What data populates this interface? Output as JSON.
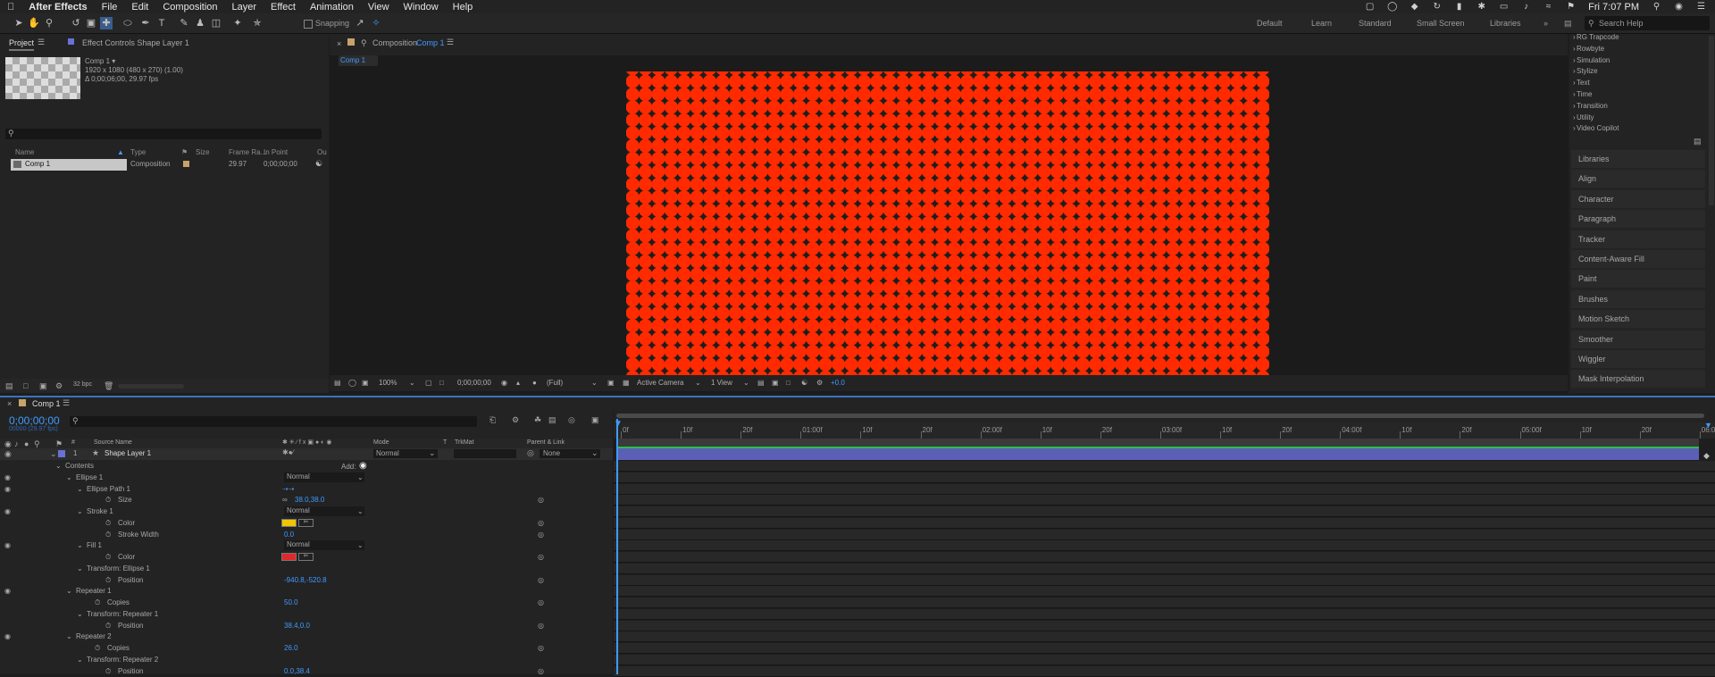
{
  "menubar": {
    "app": "After Effects",
    "items": [
      "File",
      "Edit",
      "Composition",
      "Layer",
      "Effect",
      "Animation",
      "View",
      "Window",
      "Help"
    ],
    "clock": "Fri 7:07 PM"
  },
  "toolbar": {
    "snapping": "Snapping",
    "workspaces": [
      "Default",
      "Learn",
      "Standard",
      "Small Screen",
      "Libraries"
    ],
    "search_help": "Search Help"
  },
  "project": {
    "tab": "Project",
    "tab2": "Effect Controls Shape Layer 1",
    "comp_name": "Comp 1 ▾",
    "info1": "1920 x 1080  (480 x 270) (1.00)",
    "info2": "Δ 0;00;06;00, 29.97 fps",
    "columns": [
      "Name",
      "Type",
      "Size",
      "Frame Ra...",
      "In Point",
      "Ou"
    ],
    "row": {
      "name": "Comp 1",
      "type": "Composition",
      "fps": "29.97",
      "inpoint": "0;00;00;00"
    },
    "bpc": "32 bpc"
  },
  "viewer": {
    "tab_prefix": "Composition",
    "tab_comp": "Comp 1",
    "breadcrumb": "Comp 1",
    "zoom": "100%",
    "time": "0;00;00;00",
    "resolution": "(Full)",
    "camera": "Active Camera",
    "views": "1 View",
    "exposure": "+0.0",
    "colors": {
      "dot": "#ff2a00",
      "bg": "#1e1e1e"
    }
  },
  "effects": {
    "cats": [
      "RG Trapcode",
      "Rowbyte",
      "Simulation",
      "Stylize",
      "Text",
      "Time",
      "Transition",
      "Utility",
      "Video Copilot"
    ],
    "panels": [
      "Libraries",
      "Align",
      "Character",
      "Paragraph",
      "Tracker",
      "Content-Aware Fill",
      "Paint",
      "Brushes",
      "Motion Sketch",
      "Smoother",
      "Wiggler",
      "Mask Interpolation"
    ]
  },
  "timeline": {
    "tab": "Comp 1",
    "timecode": "0;00;00;00",
    "sub": "00000 (29.97 fps)",
    "cols": {
      "num": "#",
      "source": "Source Name",
      "mode": "Mode",
      "t": "T",
      "trkmat": "TrkMat",
      "parent": "Parent & Link"
    },
    "layer": {
      "num": "1",
      "name": "Shape Layer 1",
      "mode": "Normal",
      "parent": "None"
    },
    "add": "Add:",
    "rows": [
      {
        "label": "Contents",
        "indent": 1
      },
      {
        "label": "Ellipse 1",
        "indent": 2,
        "value": "Normal",
        "dropdown": true,
        "eye": true
      },
      {
        "label": "Ellipse Path 1",
        "indent": 3,
        "eye": true
      },
      {
        "label": "Size",
        "indent": 4,
        "value": "38.0,38.0",
        "blue": true,
        "stopwatch": true
      },
      {
        "label": "Stroke 1",
        "indent": 3,
        "value": "Normal",
        "dropdown": true,
        "eye": true
      },
      {
        "label": "Color",
        "indent": 4,
        "swatch": "#f2c400",
        "stopwatch": true
      },
      {
        "label": "Stroke Width",
        "indent": 4,
        "value": "0.0",
        "blue": true,
        "stopwatch": true
      },
      {
        "label": "Fill 1",
        "indent": 3,
        "value": "Normal",
        "dropdown": true,
        "eye": true
      },
      {
        "label": "Color",
        "indent": 4,
        "swatch": "#e0282b",
        "stopwatch": true
      },
      {
        "label": "Transform: Ellipse 1",
        "indent": 3
      },
      {
        "label": "Position",
        "indent": 4,
        "value": "-940.8,-520.8",
        "blue": true,
        "stopwatch": true
      },
      {
        "label": "Repeater 1",
        "indent": 2,
        "eye": true
      },
      {
        "label": "Copies",
        "indent": 3,
        "value": "50.0",
        "blue": true,
        "stopwatch": true
      },
      {
        "label": "Transform: Repeater 1",
        "indent": 3
      },
      {
        "label": "Position",
        "indent": 4,
        "value": "38.4,0.0",
        "blue": true,
        "stopwatch": true
      },
      {
        "label": "Repeater 2",
        "indent": 2,
        "eye": true
      },
      {
        "label": "Copies",
        "indent": 3,
        "value": "26.0",
        "blue": true,
        "stopwatch": true
      },
      {
        "label": "Transform: Repeater 2",
        "indent": 3
      },
      {
        "label": "Position",
        "indent": 4,
        "value": "0.0,38.4",
        "blue": true,
        "stopwatch": true
      }
    ],
    "ruler": [
      "0f",
      "10f",
      "20f",
      "01:00f",
      "10f",
      "20f",
      "02:00f",
      "10f",
      "20f",
      "03:00f",
      "10f",
      "20f",
      "04:00f",
      "10f",
      "20f",
      "05:00f",
      "10f",
      "20f",
      "06:0"
    ]
  }
}
